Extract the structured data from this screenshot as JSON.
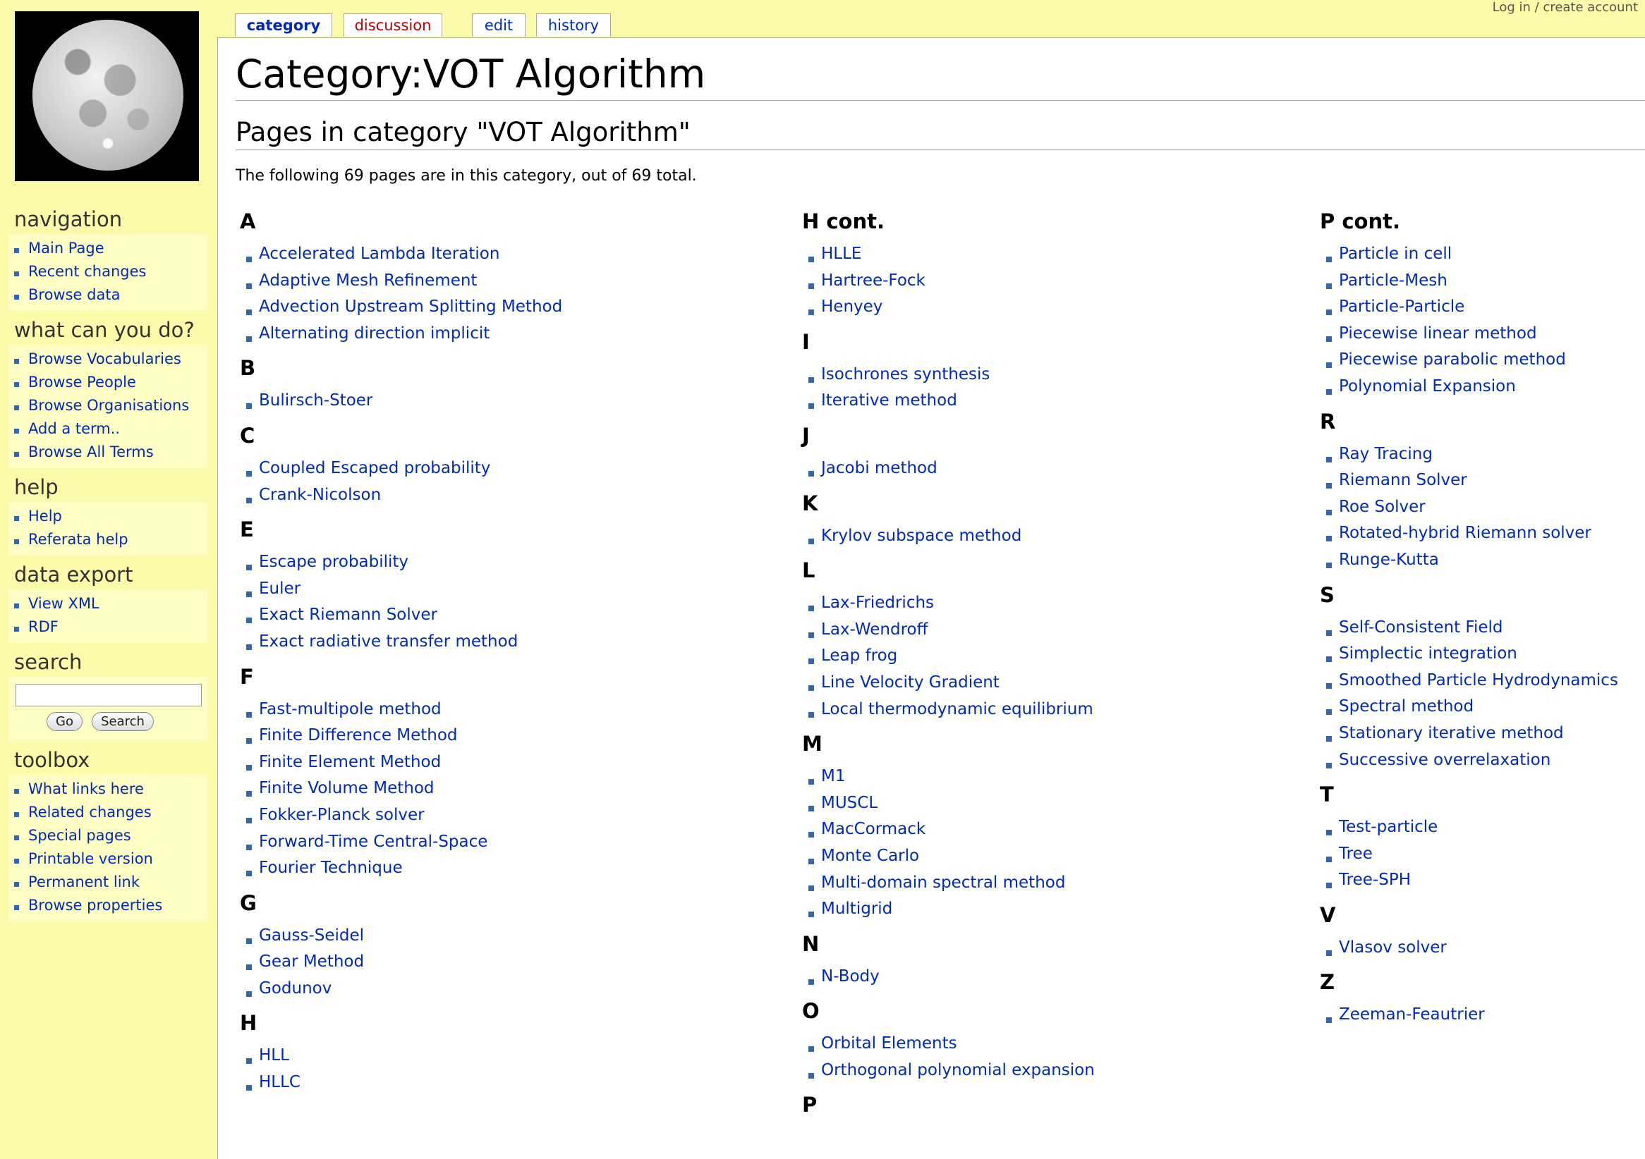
{
  "tabs": {
    "category": "category",
    "discussion": "discussion",
    "edit": "edit",
    "history": "history"
  },
  "user_links": "Log in / create account",
  "sidebar": {
    "navigation": {
      "heading": "navigation",
      "items": [
        "Main Page",
        "Recent changes",
        "Browse data"
      ]
    },
    "what_can_you_do": {
      "heading": "what can you do?",
      "items": [
        "Browse Vocabularies",
        "Browse People",
        "Browse Organisations",
        "Add a term..",
        "Browse All Terms"
      ]
    },
    "help": {
      "heading": "help",
      "items": [
        "Help",
        "Referata help"
      ]
    },
    "data_export": {
      "heading": "data export",
      "items": [
        "View XML",
        "RDF"
      ]
    },
    "search": {
      "heading": "search",
      "input_value": "",
      "go_label": "Go",
      "search_label": "Search"
    },
    "toolbox": {
      "heading": "toolbox",
      "items": [
        "What links here",
        "Related changes",
        "Special pages",
        "Printable version",
        "Permanent link",
        "Browse properties"
      ]
    }
  },
  "page": {
    "title": "Category:VOT Algorithm",
    "subheading": "Pages in category \"VOT Algorithm\"",
    "summary": "The following 69 pages are in this category, out of 69 total."
  },
  "columns": [
    {
      "groups": [
        {
          "letter": "A",
          "items": [
            "Accelerated Lambda Iteration",
            "Adaptive Mesh Refinement",
            "Advection Upstream Splitting Method",
            "Alternating direction implicit"
          ]
        },
        {
          "letter": "B",
          "items": [
            "Bulirsch-Stoer"
          ]
        },
        {
          "letter": "C",
          "items": [
            "Coupled Escaped probability",
            "Crank-Nicolson"
          ]
        },
        {
          "letter": "E",
          "items": [
            "Escape probability",
            "Euler",
            "Exact Riemann Solver",
            "Exact radiative transfer method"
          ]
        },
        {
          "letter": "F",
          "items": [
            "Fast-multipole method",
            "Finite Difference Method",
            "Finite Element Method",
            "Finite Volume Method",
            "Fokker-Planck solver",
            "Forward-Time Central-Space",
            "Fourier Technique"
          ]
        },
        {
          "letter": "G",
          "items": [
            "Gauss-Seidel",
            "Gear Method",
            "Godunov"
          ]
        },
        {
          "letter": "H",
          "items": [
            "HLL",
            "HLLC"
          ]
        }
      ]
    },
    {
      "groups": [
        {
          "letter": "H cont.",
          "items": [
            "HLLE",
            "Hartree-Fock",
            "Henyey"
          ]
        },
        {
          "letter": "I",
          "items": [
            "Isochrones synthesis",
            "Iterative method"
          ]
        },
        {
          "letter": "J",
          "items": [
            "Jacobi method"
          ]
        },
        {
          "letter": "K",
          "items": [
            "Krylov subspace method"
          ]
        },
        {
          "letter": "L",
          "items": [
            "Lax-Friedrichs",
            "Lax-Wendroff",
            "Leap frog",
            "Line Velocity Gradient",
            "Local thermodynamic equilibrium"
          ]
        },
        {
          "letter": "M",
          "items": [
            "M1",
            "MUSCL",
            "MacCormack",
            "Monte Carlo",
            "Multi-domain spectral method",
            "Multigrid"
          ]
        },
        {
          "letter": "N",
          "items": [
            "N-Body"
          ]
        },
        {
          "letter": "O",
          "items": [
            "Orbital Elements",
            "Orthogonal polynomial expansion"
          ]
        },
        {
          "letter": "P",
          "items": []
        }
      ]
    },
    {
      "groups": [
        {
          "letter": "P cont.",
          "items": [
            "Particle in cell",
            "Particle-Mesh",
            "Particle-Particle",
            "Piecewise linear method",
            "Piecewise parabolic method",
            "Polynomial Expansion"
          ]
        },
        {
          "letter": "R",
          "items": [
            "Ray Tracing",
            "Riemann Solver",
            "Roe Solver",
            "Rotated-hybrid Riemann solver",
            "Runge-Kutta"
          ]
        },
        {
          "letter": "S",
          "items": [
            "Self-Consistent Field",
            "Simplectic integration",
            "Smoothed Particle Hydrodynamics",
            "Spectral method",
            "Stationary iterative method",
            "Successive overrelaxation"
          ]
        },
        {
          "letter": "T",
          "items": [
            "Test-particle",
            "Tree",
            "Tree-SPH"
          ]
        },
        {
          "letter": "V",
          "items": [
            "Vlasov solver"
          ]
        },
        {
          "letter": "Z",
          "items": [
            "Zeeman-Feautrier"
          ]
        }
      ]
    }
  ],
  "colors": {
    "background": "#fbfba9",
    "link": "#002bb8",
    "new_link": "#ba0000"
  }
}
